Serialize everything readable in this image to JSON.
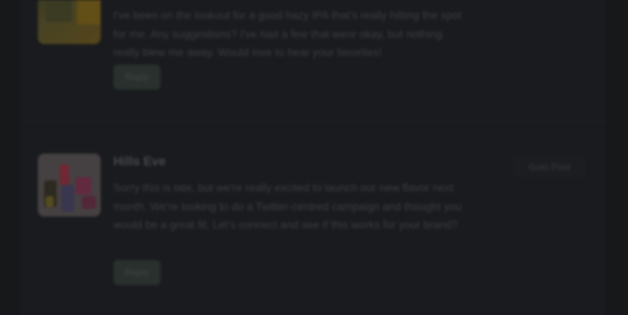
{
  "posts": [
    {
      "body": "I've been on the lookout for a good hazy IPA that's really hitting the spot for me. Any suggestions? I've had a few that were okay, but nothing really blew me away. Would love to hear your favorites!",
      "reply_label": "Reply",
      "thumbnail_icon": "beer-can-image"
    },
    {
      "title": "Hills Eve",
      "body": "Sorry this is late, but we're really excited to launch our new flavor next month. We're looking to do a Twitter-centred campaign and thought you would be a great fit. Let's connect and see if this works for your brand?",
      "reply_label": "Reply",
      "link_label": "Goto Post",
      "thumbnail_icon": "beverage-lineup-image"
    }
  ],
  "colors": {
    "background": "#17191c",
    "panel": "#1b1d20",
    "reply_button": "#2c3330"
  }
}
